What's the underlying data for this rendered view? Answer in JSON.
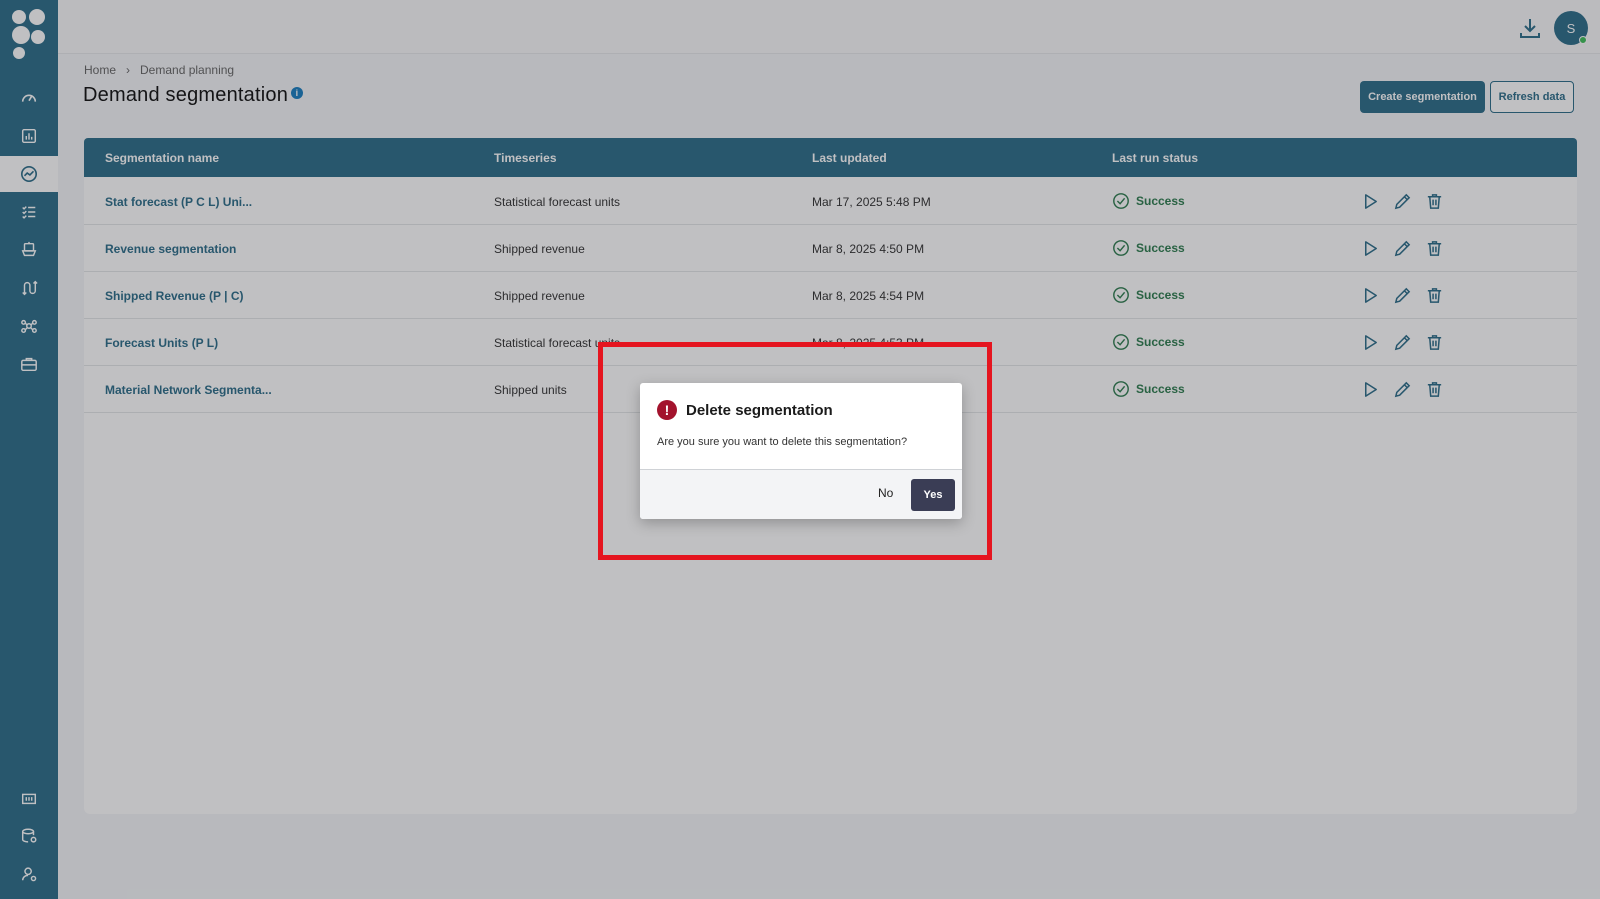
{
  "breadcrumb": {
    "home": "Home",
    "separator": "›",
    "current": "Demand planning"
  },
  "page": {
    "title": "Demand segmentation",
    "info_icon": "i"
  },
  "toolbar": {
    "create_label": "Create segmentation",
    "refresh_label": "Refresh data"
  },
  "user": {
    "initial": "S"
  },
  "table": {
    "headers": [
      "Segmentation name",
      "Timeseries",
      "Last updated",
      "Last run status"
    ],
    "rows": [
      {
        "name": "Stat forecast (P C L) Uni...",
        "timeseries": "Statistical forecast units",
        "updated": "Mar 17, 2025 5:48 PM",
        "status": "Success"
      },
      {
        "name": "Revenue segmentation",
        "timeseries": "Shipped revenue",
        "updated": "Mar 8, 2025 4:50 PM",
        "status": "Success"
      },
      {
        "name": "Shipped Revenue (P | C)",
        "timeseries": "Shipped revenue",
        "updated": "Mar 8, 2025 4:54 PM",
        "status": "Success"
      },
      {
        "name": "Forecast Units (P L)",
        "timeseries": "Statistical forecast units",
        "updated": "Mar 8, 2025 4:53 PM",
        "status": "Success"
      },
      {
        "name": "Material Network Segmenta...",
        "timeseries": "Shipped units",
        "updated": "",
        "status": "Success"
      }
    ]
  },
  "dialog": {
    "title": "Delete segmentation",
    "message": "Are you sure you want to delete this segmentation?",
    "no_label": "No",
    "yes_label": "Yes",
    "warn_icon": "!"
  },
  "colors": {
    "primary": "#2d6e8a",
    "success": "#2e7d4f",
    "danger": "#a3132d",
    "highlight": "#e5151f"
  },
  "icons": {
    "sidebar": [
      "dashboard-icon",
      "report-icon",
      "trend-icon",
      "checklist-icon",
      "ship-icon",
      "route-icon",
      "network-icon",
      "briefcase-icon",
      "inventory-icon",
      "database-settings-icon",
      "user-settings-icon"
    ],
    "row_actions": [
      "play-icon",
      "edit-icon",
      "delete-icon"
    ]
  }
}
